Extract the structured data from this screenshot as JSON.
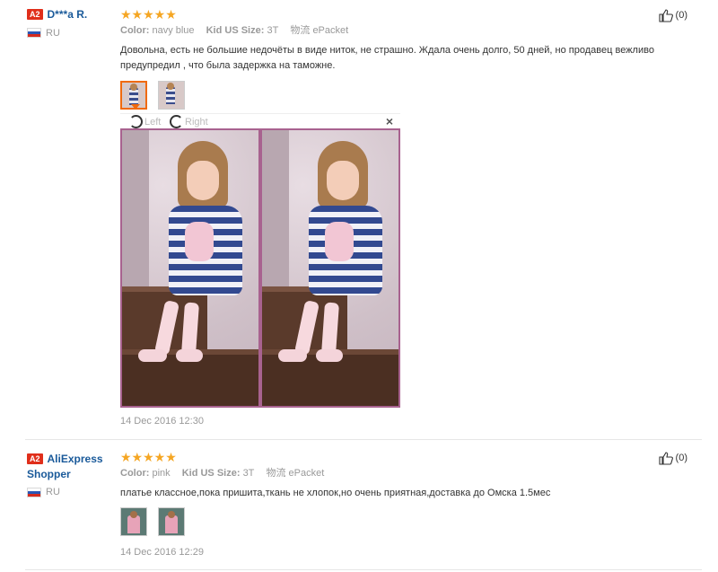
{
  "reviews": [
    {
      "level": "A2",
      "user": "D***a R.",
      "country": "RU",
      "stars": "★★★★★",
      "color_label": "Color:",
      "color_value": "navy blue",
      "size_label": "Kid US Size:",
      "size_value": "3T",
      "shipping_label": "物流",
      "shipping_value": "ePacket",
      "text": "Довольна, есть не большие недочёты в виде ниток, не страшно. Ждала очень долго, 50 дней, но продавец вежливо предупредил , что была задержка на таможне.",
      "date": "14 Dec 2016 12:30",
      "useful_count": "(0)",
      "rotate_left": "Left",
      "rotate_right": "Right",
      "close": "×"
    },
    {
      "level": "A2",
      "user": "AliExpress Shopper",
      "country": "RU",
      "stars": "★★★★★",
      "color_label": "Color:",
      "color_value": "pink",
      "size_label": "Kid US Size:",
      "size_value": "3T",
      "shipping_label": "物流",
      "shipping_value": "ePacket",
      "text": "платье классное,пока пришита,ткань не хлопок,но очень приятная,доставка до Омска 1.5мес",
      "date": "14 Dec 2016 12:29",
      "useful_count": "(0)"
    }
  ]
}
